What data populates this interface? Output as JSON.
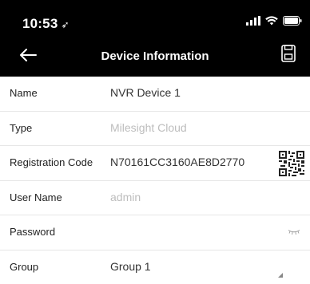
{
  "status_bar": {
    "time": "10:53",
    "location_glyph": "➶"
  },
  "nav": {
    "title": "Device Information",
    "back_icon": "back-arrow-icon",
    "save_icon": "save-icon"
  },
  "form": {
    "name": {
      "label": "Name",
      "value": "NVR Device 1"
    },
    "type": {
      "label": "Type",
      "value": "Milesight Cloud"
    },
    "registration": {
      "label": "Registration Code",
      "value": "N70161CC3160AE8D2770"
    },
    "username": {
      "label": "User Name",
      "value": "admin"
    },
    "password": {
      "label": "Password",
      "value": ""
    },
    "group": {
      "label": "Group",
      "value": "Group 1"
    }
  },
  "colors": {
    "bar": "#000000",
    "placeholder": "#bdbdbd",
    "divider": "#e6e6e6"
  }
}
